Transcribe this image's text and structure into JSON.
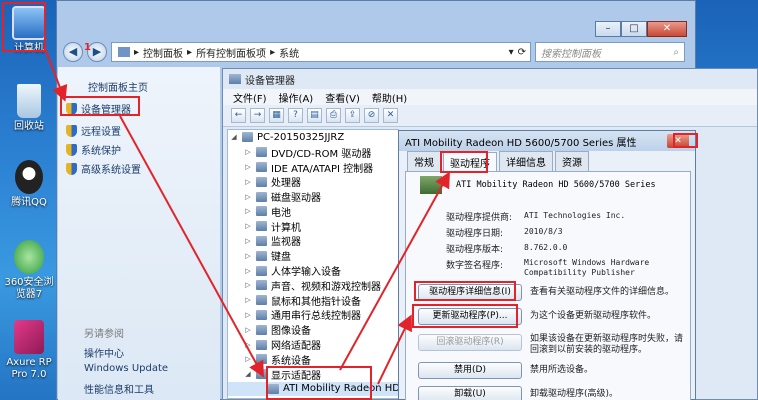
{
  "desktop": {
    "icons": [
      {
        "label": "计算机",
        "color": "#5a9fe0"
      },
      {
        "label": "回收站",
        "color": "#b8d7ef"
      },
      {
        "label": "腾讯QQ",
        "color": "#222222"
      },
      {
        "label": "360安全浏览器7",
        "color": "#3fb34f"
      },
      {
        "label": "Axure RP Pro 7.0",
        "color": "#d92a7d"
      }
    ]
  },
  "control_panel": {
    "breadcrumb": [
      "控制面板",
      "所有控制面板项",
      "系统"
    ],
    "search_placeholder": "搜索控制面板",
    "sidebar_home": "控制面板主页",
    "sidebar_links": [
      "设备管理器",
      "远程设置",
      "系统保护",
      "高级系统设置"
    ],
    "see_also_title": "另请参阅",
    "see_also_links": [
      "操作中心",
      "Windows Update",
      "性能信息和工具"
    ],
    "window_buttons": [
      "–",
      "□",
      "✕"
    ]
  },
  "device_manager": {
    "title": "设备管理器",
    "menu": [
      "文件(F)",
      "操作(A)",
      "查看(V)",
      "帮助(H)"
    ],
    "toolbar_icons": [
      "back-icon",
      "forward-icon",
      "grid-icon",
      "help-icon",
      "properties-icon",
      "scan-icon",
      "update-icon",
      "disable-icon",
      "uninstall-icon"
    ],
    "tree": {
      "root": "PC-20150325JJRZ",
      "items": [
        "DVD/CD-ROM 驱动器",
        "IDE ATA/ATAPI 控制器",
        "处理器",
        "磁盘驱动器",
        "电池",
        "计算机",
        "监视器",
        "键盘",
        "人体学输入设备",
        "声音、视频和游戏控制器",
        "鼠标和其他指针设备",
        "通用串行总线控制器",
        "图像设备",
        "网络适配器",
        "系统设备",
        "显示适配器"
      ],
      "child": "ATI Mobility Radeon HD"
    }
  },
  "properties_dialog": {
    "title": "ATI Mobility Radeon HD 5600/5700 Series 属性",
    "close": "✕",
    "tabs": [
      "常规",
      "驱动程序",
      "详细信息",
      "资源"
    ],
    "device_name": "ATI Mobility Radeon HD 5600/5700 Series",
    "props": [
      {
        "label": "驱动程序提供商:",
        "value": "ATI Technologies Inc."
      },
      {
        "label": "驱动程序日期:",
        "value": "2010/8/3"
      },
      {
        "label": "驱动程序版本:",
        "value": "8.762.0.0"
      },
      {
        "label": "数字签名程序:",
        "value": "Microsoft Windows Hardware Compatibility Publisher"
      }
    ],
    "buttons": [
      {
        "label": "驱动程序详细信息(I)",
        "desc": "查看有关驱动程序文件的详细信息。",
        "enabled": true
      },
      {
        "label": "更新驱动程序(P)...",
        "desc": "为这个设备更新驱动程序软件。",
        "enabled": true
      },
      {
        "label": "回滚驱动程序(R)",
        "desc": "如果该设备在更新驱动程序时失败，请回滚到以前安装的驱动程序。",
        "enabled": false
      },
      {
        "label": "禁用(D)",
        "desc": "禁用所选设备。",
        "enabled": true
      },
      {
        "label": "卸载(U)",
        "desc": "卸载驱动程序(高级)。",
        "enabled": true
      }
    ]
  },
  "annotations": {
    "step_number": "1",
    "color": "#e2242a"
  }
}
